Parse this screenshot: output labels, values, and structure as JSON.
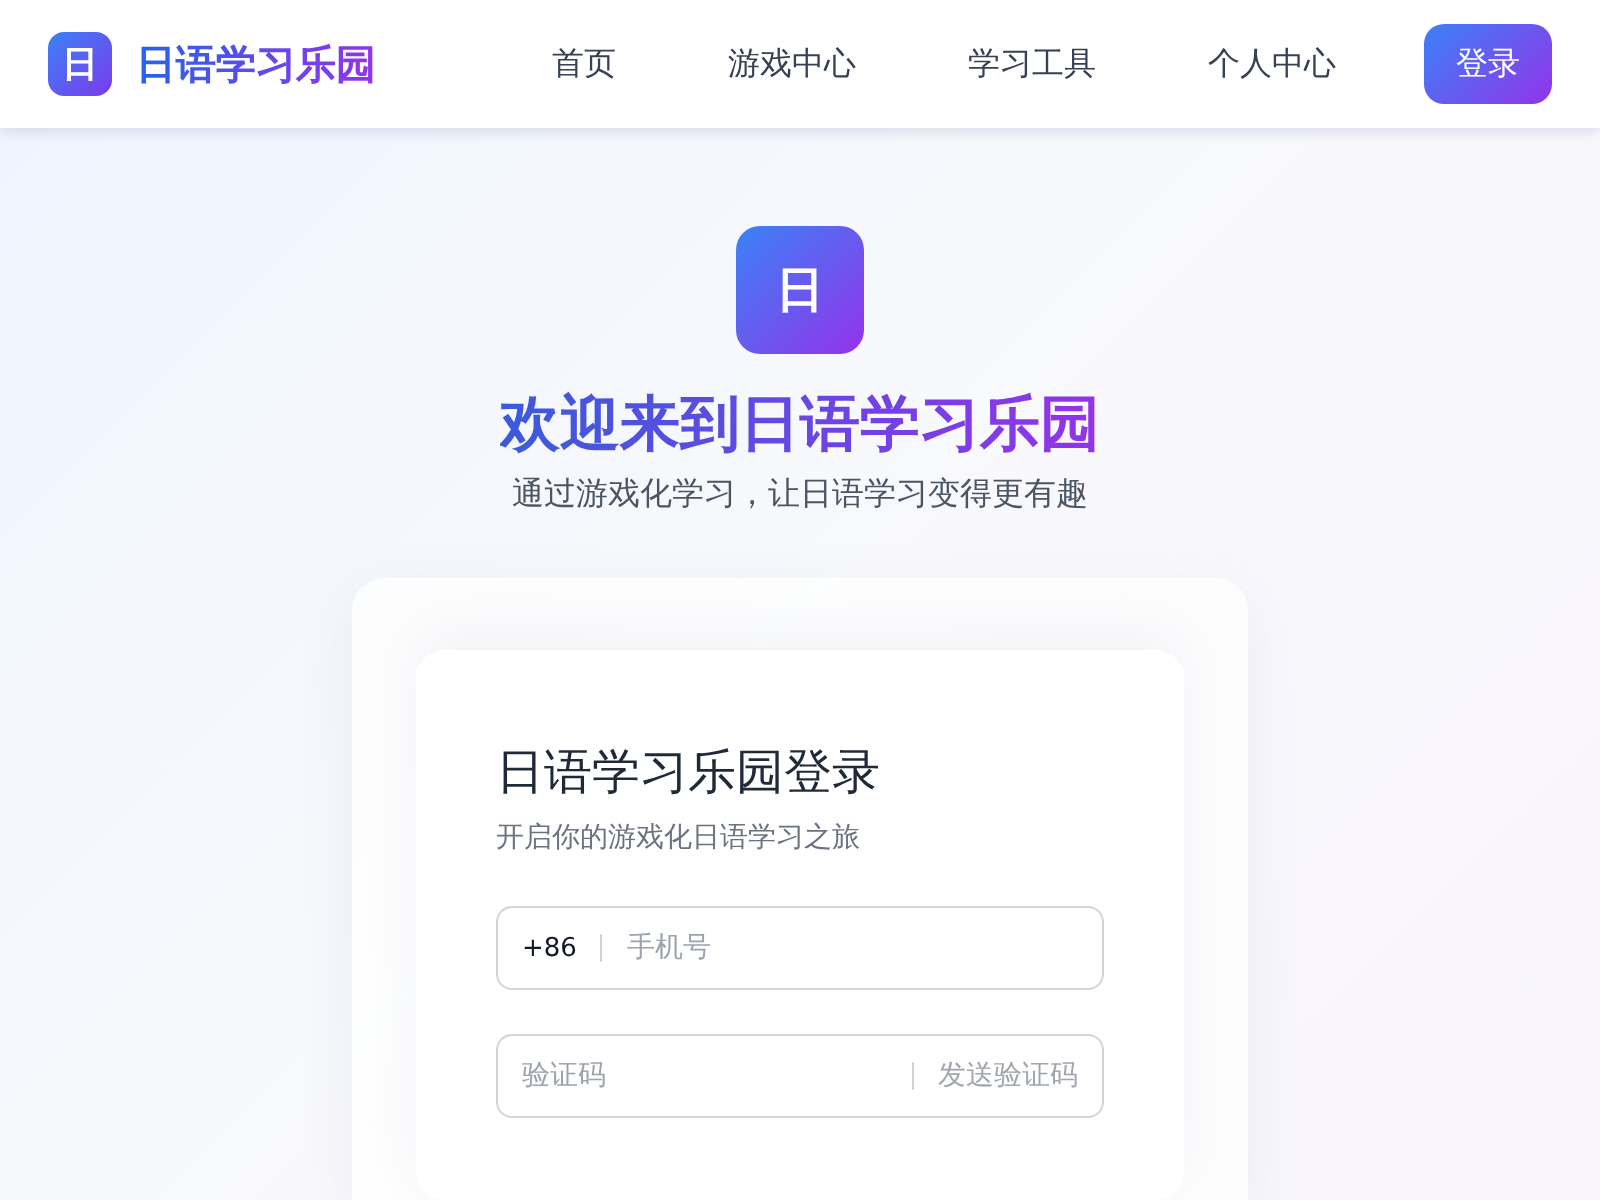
{
  "header": {
    "logo_glyph": "日",
    "brand": "日语学习乐园",
    "nav": [
      "首页",
      "游戏中心",
      "学习工具",
      "个人中心"
    ],
    "login_button": "登录"
  },
  "hero": {
    "logo_glyph": "日",
    "title": "欢迎来到日语学习乐园",
    "subtitle": "通过游戏化学习，让日语学习变得更有趣"
  },
  "login_card": {
    "title": "日语学习乐园登录",
    "subtitle": "开启你的游戏化日语学习之旅",
    "phone_field": {
      "prefix": "+86",
      "placeholder": "手机号"
    },
    "code_field": {
      "placeholder": "验证码",
      "send_button": "发送验证码"
    }
  }
}
